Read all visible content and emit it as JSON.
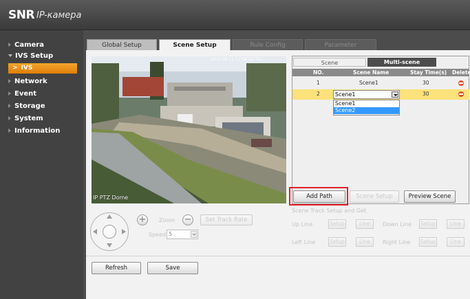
{
  "header": {
    "logo_mark": "SNR",
    "logo_text": "IP-камера"
  },
  "sidebar": {
    "items": [
      {
        "label": "Camera"
      },
      {
        "label": "IVS Setup"
      },
      {
        "label": "IVS"
      },
      {
        "label": "Network"
      },
      {
        "label": "Event"
      },
      {
        "label": "Storage"
      },
      {
        "label": "System"
      },
      {
        "label": "Information"
      }
    ]
  },
  "tabs": [
    {
      "label": "Global Setup"
    },
    {
      "label": "Scene Setup"
    },
    {
      "label": "Rule Config"
    },
    {
      "label": "Parameter"
    }
  ],
  "video": {
    "overlay": "IP PTZ Dome",
    "timestamp": "2016-08-11 12:04:22 Thu"
  },
  "scene_tabs": {
    "scene": "Scene",
    "multi_scene": "Multi-scene"
  },
  "table": {
    "headers": {
      "no": "NO.",
      "name": "Scene Name",
      "stay": "Stay Time(s)",
      "delete": "Delete"
    },
    "rows": [
      {
        "no": "1",
        "name": "Scene1",
        "stay": "30"
      },
      {
        "no": "2",
        "name": "Scene1",
        "stay": "30"
      }
    ]
  },
  "dropdown": {
    "value": "Scene1",
    "options": [
      "Scene1",
      "Scene2"
    ]
  },
  "buttons": {
    "add_path": "Add Path",
    "scene_setup": "Scene Setup",
    "preview_scene": "Preview Scene",
    "set_track_rate": "Set Track Rate",
    "refresh": "Refresh",
    "save": "Save",
    "setup": "Setup",
    "line": "Line"
  },
  "track": {
    "title": "Scene Track Setup and Get",
    "up_line": "Up Line",
    "down_line": "Down Line",
    "left_line": "Left Line",
    "right_line": "Right Line"
  },
  "ptz": {
    "zoom_label": "Zoom",
    "speed_label": "Speed",
    "speed_value": "5"
  },
  "colors": {
    "accent": "#f08c14",
    "highlight": "#e3212c",
    "selection": "#3399ff",
    "row_selected": "#fbe27a"
  }
}
